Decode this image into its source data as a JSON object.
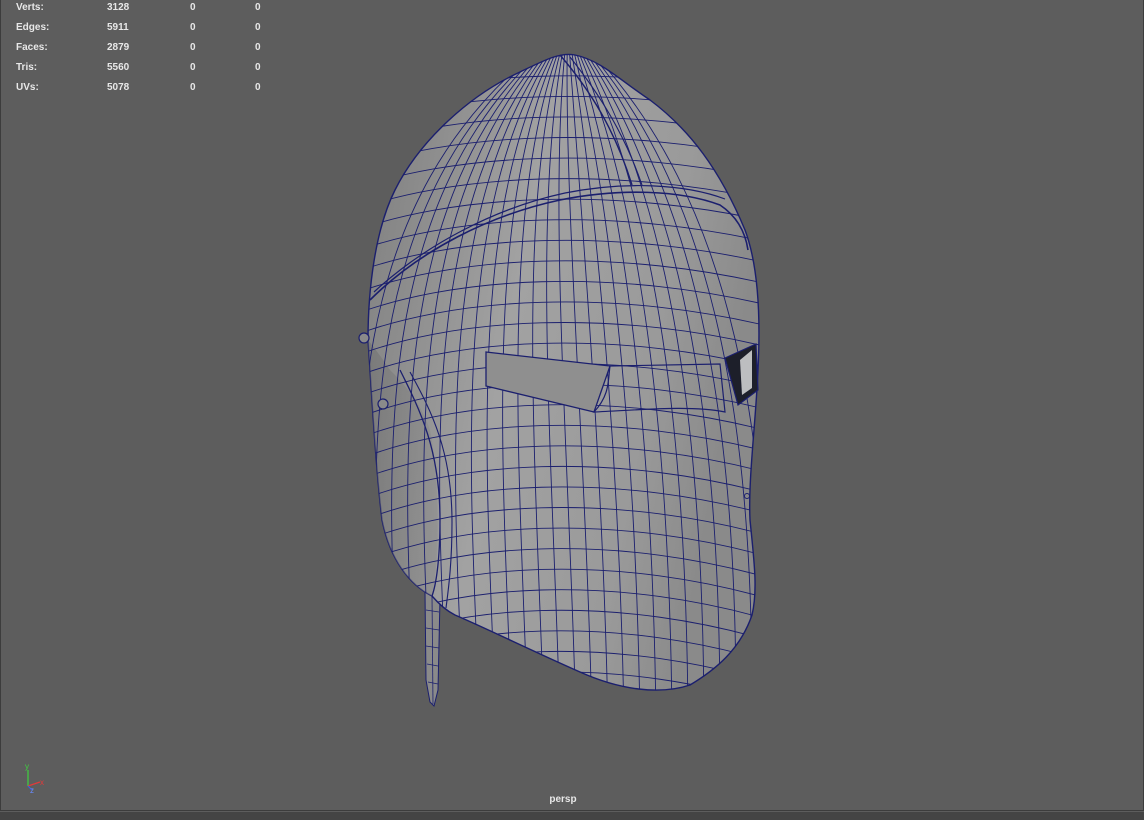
{
  "stats": [
    {
      "label": "Verts:",
      "total": "3128",
      "selected": "0",
      "highlighted": "0"
    },
    {
      "label": "Edges:",
      "total": "5911",
      "selected": "0",
      "highlighted": "0"
    },
    {
      "label": "Faces:",
      "total": "2879",
      "selected": "0",
      "highlighted": "0"
    },
    {
      "label": "Tris:",
      "total": "5560",
      "selected": "0",
      "highlighted": "0"
    },
    {
      "label": "UVs:",
      "total": "5078",
      "selected": "0",
      "highlighted": "0"
    }
  ],
  "viewport": {
    "camera": "persp",
    "background_color": "#5d5d5d",
    "shaded_color": "#9a9a9a",
    "wireframe_color": "#1b1f6e"
  },
  "axis_gizmo": {
    "y_label": "y",
    "z_label": "z",
    "x_label": "x"
  }
}
